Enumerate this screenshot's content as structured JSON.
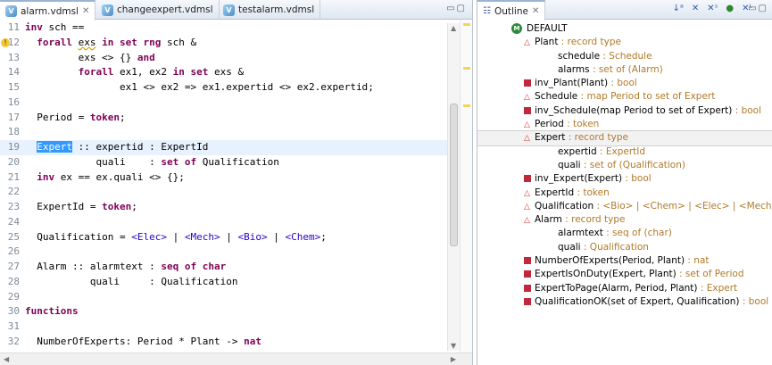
{
  "editor": {
    "tabs": [
      {
        "label": "alarm.vdmsl",
        "close": "✕",
        "icon": "vdm-file-icon"
      },
      {
        "label": "changeexpert.vdmsl",
        "icon": "vdm-file-icon"
      },
      {
        "label": "testalarm.vdmsl",
        "icon": "vdm-file-icon"
      }
    ],
    "lines": [
      {
        "n": "11",
        "t": "inv sch =="
      },
      {
        "n": "12",
        "t": "  forall exs in set rng sch &"
      },
      {
        "n": "13",
        "t": "         exs <> {} and"
      },
      {
        "n": "14",
        "t": "         forall ex1, ex2 in set exs &"
      },
      {
        "n": "15",
        "t": "                ex1 <> ex2 => ex1.expertid <> ex2.expertid;"
      },
      {
        "n": "16",
        "t": ""
      },
      {
        "n": "17",
        "t": "  Period = token;"
      },
      {
        "n": "18",
        "t": ""
      },
      {
        "n": "19",
        "t": "  Expert :: expertid : ExpertId"
      },
      {
        "n": "20",
        "t": "            quali    : set of Qualification"
      },
      {
        "n": "21",
        "t": "  inv ex == ex.quali <> {};"
      },
      {
        "n": "22",
        "t": ""
      },
      {
        "n": "23",
        "t": "  ExpertId = token;"
      },
      {
        "n": "24",
        "t": ""
      },
      {
        "n": "25",
        "t": "  Qualification = <Elec> | <Mech> | <Bio> | <Chem>;"
      },
      {
        "n": "26",
        "t": ""
      },
      {
        "n": "27",
        "t": "  Alarm :: alarmtext : seq of char"
      },
      {
        "n": "28",
        "t": "           quali     : Qualification"
      },
      {
        "n": "29",
        "t": ""
      },
      {
        "n": "30",
        "t": "functions"
      },
      {
        "n": "31",
        "t": ""
      },
      {
        "n": "32",
        "t": "  NumberOfExperts: Period * Plant -> nat"
      }
    ],
    "warning_line": "12",
    "selected_word": "Expert"
  },
  "outline": {
    "title": "Outline",
    "close": "✕",
    "tools": [
      "sort-icon",
      "hide-fields-icon",
      "hide-static-icon",
      "hide-nonpublic-icon",
      "hide-local-icon"
    ],
    "items": [
      {
        "level": 0,
        "icon": "module",
        "name": "DEFAULT",
        "type": ""
      },
      {
        "level": 1,
        "icon": "type",
        "name": "Plant",
        "type": " : record type"
      },
      {
        "level": 2,
        "icon": "",
        "name": "schedule",
        "type": " : Schedule"
      },
      {
        "level": 2,
        "icon": "",
        "name": "alarms",
        "type": " : set of (Alarm)"
      },
      {
        "level": 1,
        "icon": "func",
        "name": "inv_Plant(Plant)",
        "type": " : bool"
      },
      {
        "level": 1,
        "icon": "type",
        "name": "Schedule",
        "type": " : map Period to set of Expert"
      },
      {
        "level": 1,
        "icon": "func",
        "name": "inv_Schedule(map Period to set of Expert)",
        "type": " : bool"
      },
      {
        "level": 1,
        "icon": "type",
        "name": "Period",
        "type": " : token"
      },
      {
        "level": 1,
        "icon": "type",
        "name": "Expert",
        "type": " : record type",
        "selected": true
      },
      {
        "level": 2,
        "icon": "",
        "name": "expertid",
        "type": " : ExpertId"
      },
      {
        "level": 2,
        "icon": "",
        "name": "quali",
        "type": " : set of (Qualification)"
      },
      {
        "level": 1,
        "icon": "func",
        "name": "inv_Expert(Expert)",
        "type": " : bool"
      },
      {
        "level": 1,
        "icon": "type",
        "name": "ExpertId",
        "type": " : token"
      },
      {
        "level": 1,
        "icon": "type",
        "name": "Qualification",
        "type": " : <Bio> | <Chem> | <Elec> | <Mech>"
      },
      {
        "level": 1,
        "icon": "type",
        "name": "Alarm",
        "type": " : record type"
      },
      {
        "level": 2,
        "icon": "",
        "name": "alarmtext",
        "type": " : seq of (char)"
      },
      {
        "level": 2,
        "icon": "",
        "name": "quali",
        "type": " : Qualification"
      },
      {
        "level": 1,
        "icon": "func",
        "name": "NumberOfExperts(Period, Plant)",
        "type": " : nat"
      },
      {
        "level": 1,
        "icon": "func",
        "name": "ExpertIsOnDuty(Expert, Plant)",
        "type": " : set of Period"
      },
      {
        "level": 1,
        "icon": "funcpre",
        "name": "ExpertToPage(Alarm, Period, Plant)",
        "type": " : Expert"
      },
      {
        "level": 1,
        "icon": "func",
        "name": "QualificationOK(set of Expert, Qualification)",
        "type": " : bool"
      }
    ]
  },
  "colors": {
    "keyword": "#7f0055",
    "quote": "#2a00c8",
    "selection": "#3399ff",
    "outline_type": "#b07a2a"
  }
}
